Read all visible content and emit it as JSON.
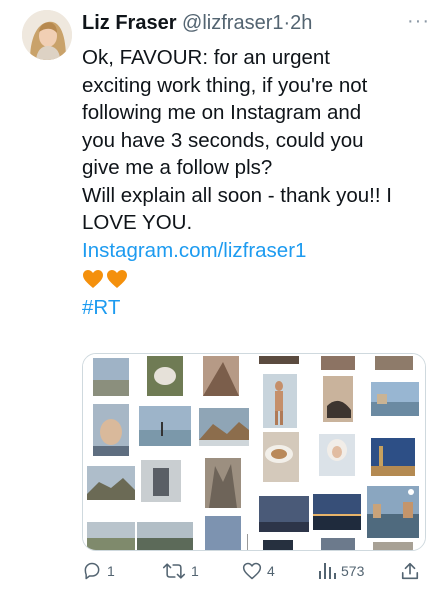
{
  "tweet": {
    "author_name": "Liz Fraser",
    "handle": "@lizfraser1",
    "separator": "·",
    "time": "2h",
    "more_label": "···",
    "text_lines": [
      "Ok, FAVOUR: for an urgent",
      "exciting work thing, if you're not",
      "following me on Instagram and",
      "you have 3 seconds, could you",
      "give me a follow pls?",
      "Will explain all soon - thank you!! I",
      "LOVE YOU."
    ],
    "link": "Instagram.com/lizfraser1",
    "emoji": [
      "🧡",
      "🧡"
    ],
    "hashtag": "#RT"
  },
  "actions": {
    "replies": "1",
    "retweets": "1",
    "likes": "4",
    "views": "573"
  },
  "colors": {
    "link": "#1d9bf0",
    "muted": "#536471",
    "heart_orange": "#f4900c"
  },
  "icons": [
    "ellipsis-icon",
    "reply-icon",
    "retweet-icon",
    "like-icon",
    "views-icon",
    "share-icon"
  ]
}
